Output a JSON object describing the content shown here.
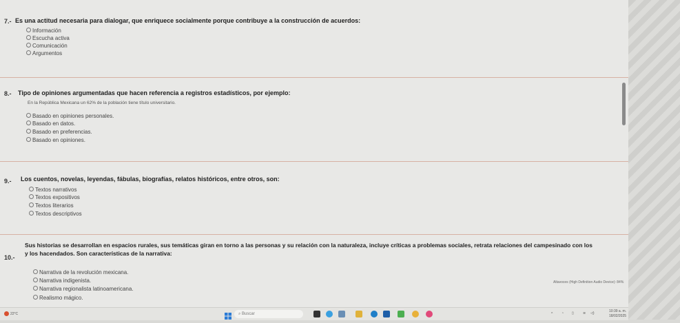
{
  "questions": [
    {
      "number": "7.-",
      "text": "Es una actitud necesaria para dialogar, que enriquece socialmente porque contribuye a la construcción de acuerdos:",
      "options": [
        "Información",
        "Escucha activa",
        "Comunicación",
        "Argumentos"
      ]
    },
    {
      "number": "8.-",
      "text": "Tipo de opiniones argumentadas que hacen referencia a registros estadísticos, por ejemplo:",
      "example": "En la República Mexicana un 62% de la población tiene título universitario.",
      "options": [
        "Basado en opiniones personales.",
        "Basado en datos.",
        "Basado en preferencias.",
        "Basado en opiniones."
      ]
    },
    {
      "number": "9.-",
      "text": "Los cuentos, novelas, leyendas, fábulas, biografías, relatos históricos, entre otros, son:",
      "options": [
        "Textos narrativos",
        "Textos expositivos",
        "Textos literarios",
        "Textos descriptivos"
      ]
    },
    {
      "number": "10.-",
      "text_line1": "Sus historias se desarrollan en espacios rurales, sus temáticas giran en torno a las personas y su relación con la naturaleza, incluye críticas a problemas sociales, retrata relaciones del campesinado con los",
      "text_line2": "y los hacendados. Son características de la narrativa:",
      "options": [
        "Narrativa de la revolución mexicana.",
        "Narrativa indigenista.",
        "Narrativa regionalista latinoamericana.",
        "Realismo mágico."
      ]
    }
  ],
  "volume_notification": "Altavoces (High Definition Audio Device): 84%",
  "taskbar": {
    "weather": "22°C",
    "search_placeholder": "Buscar",
    "time": "10:39 a. m.",
    "date": "18/02/2025"
  },
  "colors": {
    "divider": "#d6b0a3",
    "weather_badge": "#d8502f"
  }
}
